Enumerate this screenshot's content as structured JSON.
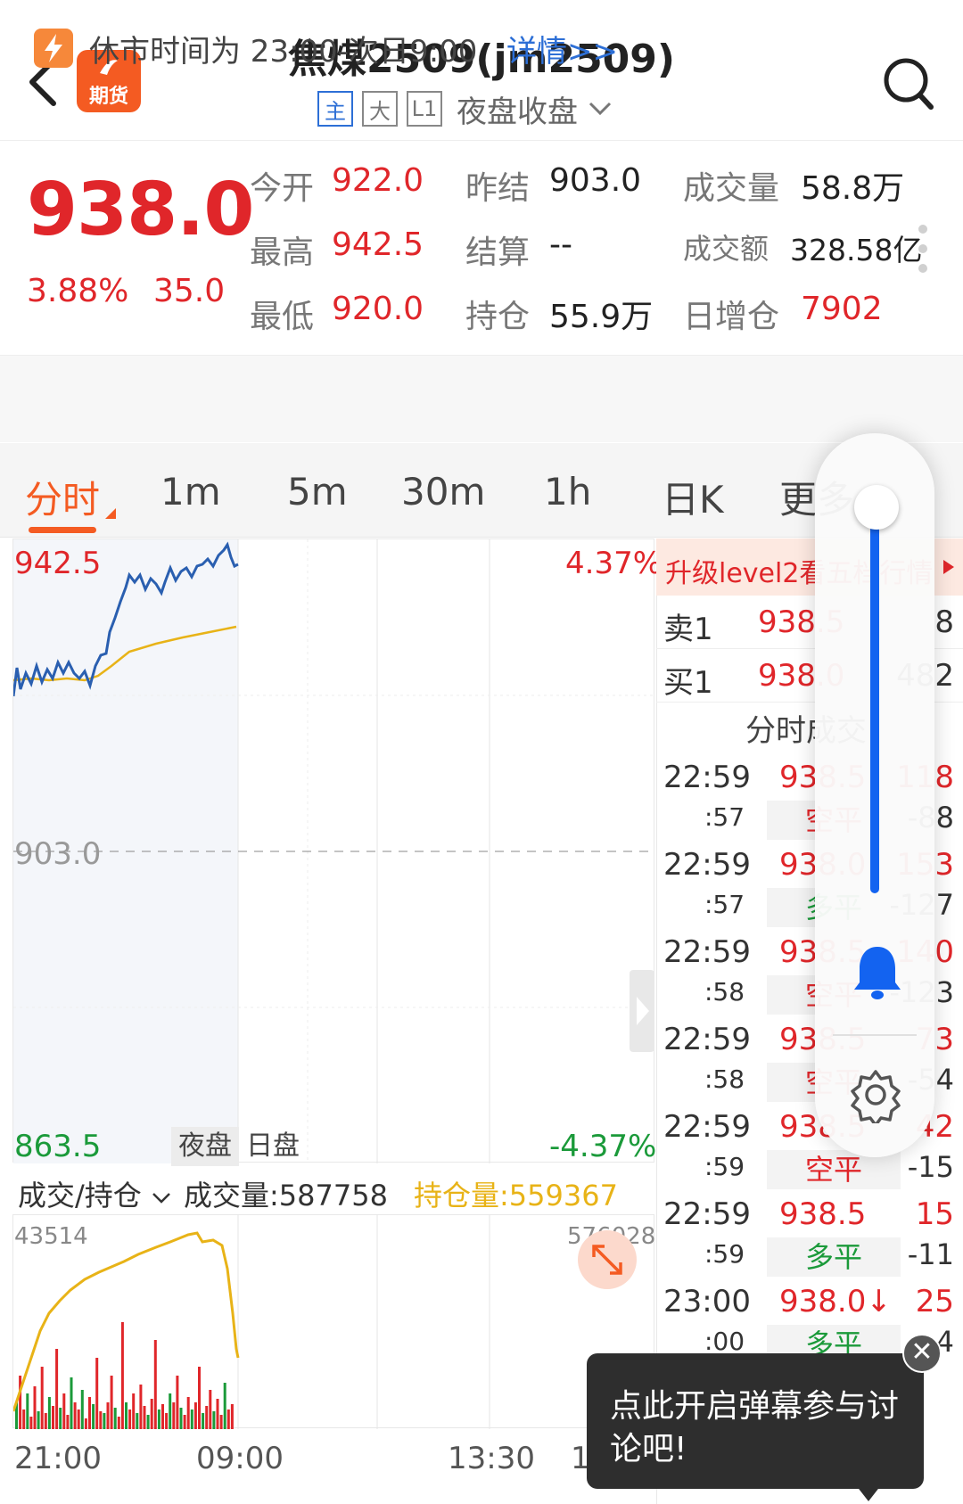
{
  "header": {
    "title": "焦煤2509(jm2509)",
    "tags": [
      "主",
      "大",
      "L1"
    ],
    "session": "夜盘收盘",
    "logo_text": "期货"
  },
  "quote": {
    "price": "938.0",
    "pct": "3.88%",
    "change": "35.0",
    "fields": [
      {
        "label": "今开",
        "value": "922.0",
        "color": "red"
      },
      {
        "label": "昨结",
        "value": "903.0",
        "color": "dark"
      },
      {
        "label": "成交量",
        "value": "58.8万",
        "color": "dark"
      },
      {
        "label": "最高",
        "value": "942.5",
        "color": "red"
      },
      {
        "label": "结算",
        "value": "--",
        "color": "dark"
      },
      {
        "label": "成交额",
        "value": "328.58亿",
        "color": "dark"
      },
      {
        "label": "最低",
        "value": "920.0",
        "color": "red"
      },
      {
        "label": "持仓",
        "value": "55.9万",
        "color": "dark"
      },
      {
        "label": "日增仓",
        "value": "7902",
        "color": "red"
      }
    ]
  },
  "notice": {
    "text": "休市时间为 23:00-次日9:00",
    "link": "详情>>"
  },
  "tabs": [
    "分时",
    "1m",
    "5m",
    "30m",
    "1h",
    "日K",
    "更多"
  ],
  "chart": {
    "high": "942.5",
    "high_pct": "4.37%",
    "mid": "903.0",
    "low": "863.5",
    "low_pct": "-4.37%",
    "night_label": "夜盘",
    "day_label": "日盘",
    "vol_select": "成交/持仓",
    "vol_label": "成交量:587758",
    "oi_label": "持仓量:559367",
    "vol_left": "43514",
    "vol_right": "576028",
    "times": [
      "21:00",
      "09:00",
      "13:30",
      "1"
    ]
  },
  "right_panel": {
    "level2": "升级level2看五档行情",
    "sell1": {
      "label": "卖1",
      "price": "938.5",
      "qty": "8"
    },
    "buy1": {
      "label": "买1",
      "price": "938.0",
      "qty": "482"
    },
    "tick_title": "分时成交",
    "ticks": [
      {
        "time": "22:59",
        "sec": ":57",
        "price": "938.5",
        "vol": "118",
        "type": "空平",
        "oi": "-88",
        "pc": "red",
        "tc": "red"
      },
      {
        "time": "22:59",
        "sec": ":57",
        "price": "938.0",
        "vol": "153",
        "type": "多平",
        "oi": "-127",
        "pc": "red",
        "tc": "green"
      },
      {
        "time": "22:59",
        "sec": ":58",
        "price": "938.5",
        "vol": "140",
        "type": "空平",
        "oi": "-123",
        "pc": "red",
        "tc": "red"
      },
      {
        "time": "22:59",
        "sec": ":58",
        "price": "938.5",
        "vol": "73",
        "type": "空平",
        "oi": "-54",
        "pc": "red",
        "tc": "red"
      },
      {
        "time": "22:59",
        "sec": ":59",
        "price": "938.5",
        "vol": "42",
        "type": "空平",
        "oi": "-15",
        "pc": "red",
        "tc": "red"
      },
      {
        "time": "22:59",
        "sec": ":59",
        "price": "938.5",
        "vol": "15",
        "type": "多平",
        "oi": "-11",
        "pc": "red",
        "tc": "green"
      },
      {
        "time": "23:00",
        "sec": ":00",
        "price": "938.0↓",
        "vol": "25",
        "type": "多平",
        "oi": "-4",
        "pc": "red",
        "tc": "green"
      }
    ]
  },
  "toast": {
    "text": "点此开启弹幕参与讨论吧!"
  },
  "colors": {
    "accent": "#f45b22",
    "up": "#e0262a",
    "down": "#1b9a3a",
    "price_line": "#2a5fb0",
    "avg_line": "#e8b317",
    "slider": "#1363f0"
  }
}
